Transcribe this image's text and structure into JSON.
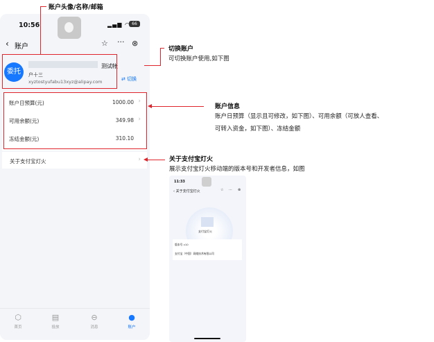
{
  "phone": {
    "time": "10:56",
    "battery": "66",
    "nav_title": "账户",
    "account": {
      "avatar_text": "委托",
      "name_suffix": "测试帐",
      "name_line2": "户十三",
      "email": "xyztostyufabu13xyz@alipay.com",
      "switch_label": "切换"
    },
    "info_rows": [
      {
        "label": "账户日预算(元)",
        "value": "1000.00"
      },
      {
        "label": "可用余额(元)",
        "value": "349.98"
      },
      {
        "label": "冻结金额(元)",
        "value": "310.10"
      }
    ],
    "about_label": "关于支付宝灯火",
    "tabs": [
      {
        "label": "首页",
        "icon": "home-icon"
      },
      {
        "label": "投放",
        "icon": "document-icon"
      },
      {
        "label": "消息",
        "icon": "message-icon"
      },
      {
        "label": "账户",
        "icon": "user-icon"
      }
    ]
  },
  "annotations": {
    "avatar_note": "账户头像/名称/邮箱",
    "switch_title": "切换账户",
    "switch_desc": "可切换账户使用,如下图",
    "info_title": "账户信息",
    "info_desc_1": "账户日预算（显示且可修改，如下图）、可用余额（可放人查看、",
    "info_desc_2": "可转入资金，如下图）、冻结金额",
    "about_title": "关于支付宝灯火",
    "about_desc": "展示支付宝灯火移动端的版本号和开发者信息，如图"
  },
  "mini": {
    "time": "11:33",
    "nav_title": "关于支付宝灯火",
    "app_name": "支付宝灯火",
    "version_row": "版本号 v10",
    "dev_row": "支付宝（中国）网络技术有限公司"
  },
  "colors": {
    "accent": "#1677ff",
    "annotation": "#e0242b"
  }
}
